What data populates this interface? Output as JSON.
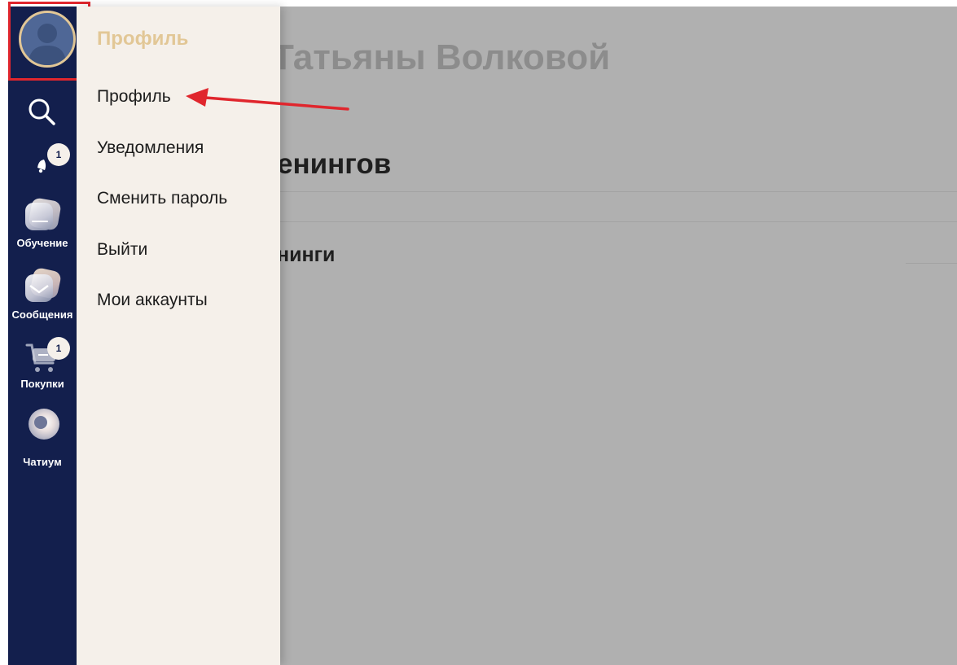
{
  "page": {
    "title": "Татьяны Волковой",
    "section_heading": "енингов",
    "subsection_heading": "нинги"
  },
  "sidebar": {
    "avatar_alt": "Профиль",
    "items": [
      {
        "label": "",
        "icon": "search-icon"
      },
      {
        "label": "",
        "icon": "bell-icon",
        "badge": "1"
      },
      {
        "label": "Обучение",
        "icon": "learning-icon"
      },
      {
        "label": "Сообщения",
        "icon": "messages-icon"
      },
      {
        "label": "Покупки",
        "icon": "cart-icon",
        "badge": "1"
      },
      {
        "label": "Чатиум",
        "icon": "chatium-icon"
      }
    ]
  },
  "menu": {
    "title": "Профиль",
    "items": [
      {
        "label": "Профиль"
      },
      {
        "label": "Уведомления"
      },
      {
        "label": "Сменить пароль"
      },
      {
        "label": "Выйти"
      },
      {
        "label": "Мои аккаунты"
      }
    ]
  },
  "colors": {
    "rail": "#131f4d",
    "menu_bg": "#f5f0ea",
    "menu_title": "#e2c796",
    "overlay": "#b0b0b0",
    "annotation": "#e0262d"
  }
}
